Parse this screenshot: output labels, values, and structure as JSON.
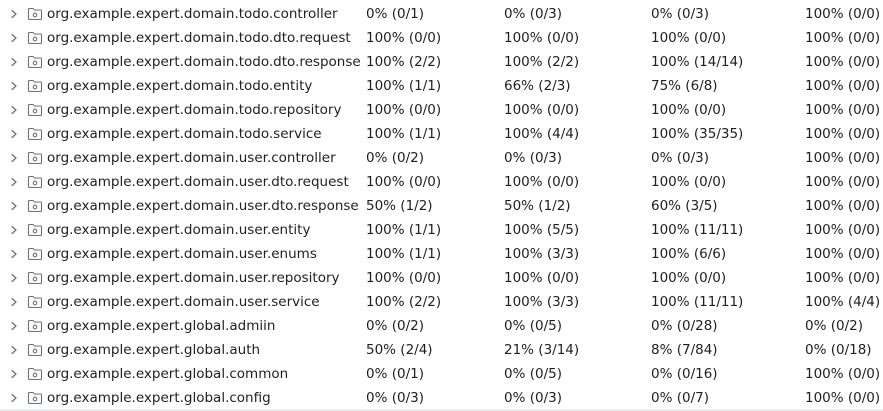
{
  "rows": [
    {
      "name": "org.example.expert.domain.todo.controller",
      "class_cov": "0% (0/1)",
      "method_cov": "0% (0/3)",
      "line_cov": "0% (0/3)",
      "branch_cov": "100% (0/0)"
    },
    {
      "name": "org.example.expert.domain.todo.dto.request",
      "class_cov": "100% (0/0)",
      "method_cov": "100% (0/0)",
      "line_cov": "100% (0/0)",
      "branch_cov": "100% (0/0)"
    },
    {
      "name": "org.example.expert.domain.todo.dto.response",
      "class_cov": "100% (2/2)",
      "method_cov": "100% (2/2)",
      "line_cov": "100% (14/14)",
      "branch_cov": "100% (0/0)"
    },
    {
      "name": "org.example.expert.domain.todo.entity",
      "class_cov": "100% (1/1)",
      "method_cov": "66% (2/3)",
      "line_cov": "75% (6/8)",
      "branch_cov": "100% (0/0)"
    },
    {
      "name": "org.example.expert.domain.todo.repository",
      "class_cov": "100% (0/0)",
      "method_cov": "100% (0/0)",
      "line_cov": "100% (0/0)",
      "branch_cov": "100% (0/0)"
    },
    {
      "name": "org.example.expert.domain.todo.service",
      "class_cov": "100% (1/1)",
      "method_cov": "100% (4/4)",
      "line_cov": "100% (35/35)",
      "branch_cov": "100% (0/0)"
    },
    {
      "name": "org.example.expert.domain.user.controller",
      "class_cov": "0% (0/2)",
      "method_cov": "0% (0/3)",
      "line_cov": "0% (0/3)",
      "branch_cov": "100% (0/0)"
    },
    {
      "name": "org.example.expert.domain.user.dto.request",
      "class_cov": "100% (0/0)",
      "method_cov": "100% (0/0)",
      "line_cov": "100% (0/0)",
      "branch_cov": "100% (0/0)"
    },
    {
      "name": "org.example.expert.domain.user.dto.response",
      "class_cov": "50% (1/2)",
      "method_cov": "50% (1/2)",
      "line_cov": "60% (3/5)",
      "branch_cov": "100% (0/0)"
    },
    {
      "name": "org.example.expert.domain.user.entity",
      "class_cov": "100% (1/1)",
      "method_cov": "100% (5/5)",
      "line_cov": "100% (11/11)",
      "branch_cov": "100% (0/0)"
    },
    {
      "name": "org.example.expert.domain.user.enums",
      "class_cov": "100% (1/1)",
      "method_cov": "100% (3/3)",
      "line_cov": "100% (6/6)",
      "branch_cov": "100% (0/0)"
    },
    {
      "name": "org.example.expert.domain.user.repository",
      "class_cov": "100% (0/0)",
      "method_cov": "100% (0/0)",
      "line_cov": "100% (0/0)",
      "branch_cov": "100% (0/0)"
    },
    {
      "name": "org.example.expert.domain.user.service",
      "class_cov": "100% (2/2)",
      "method_cov": "100% (3/3)",
      "line_cov": "100% (11/11)",
      "branch_cov": "100% (4/4)"
    },
    {
      "name": "org.example.expert.global.admiin",
      "class_cov": "0% (0/2)",
      "method_cov": "0% (0/5)",
      "line_cov": "0% (0/28)",
      "branch_cov": "0% (0/2)"
    },
    {
      "name": "org.example.expert.global.auth",
      "class_cov": "50% (2/4)",
      "method_cov": "21% (3/14)",
      "line_cov": "8% (7/84)",
      "branch_cov": "0% (0/18)"
    },
    {
      "name": "org.example.expert.global.common",
      "class_cov": "0% (0/1)",
      "method_cov": "0% (0/5)",
      "line_cov": "0% (0/16)",
      "branch_cov": "100% (0/0)"
    },
    {
      "name": "org.example.expert.global.config",
      "class_cov": "0% (0/3)",
      "method_cov": "0% (0/3)",
      "line_cov": "0% (0/7)",
      "branch_cov": "100% (0/0)"
    }
  ],
  "icons": {
    "expand": "chevron-right-icon",
    "package": "package-folder-icon"
  },
  "colors": {
    "text": "#1f1f1f",
    "icon": "#6c707e",
    "background": "#ffffff"
  }
}
